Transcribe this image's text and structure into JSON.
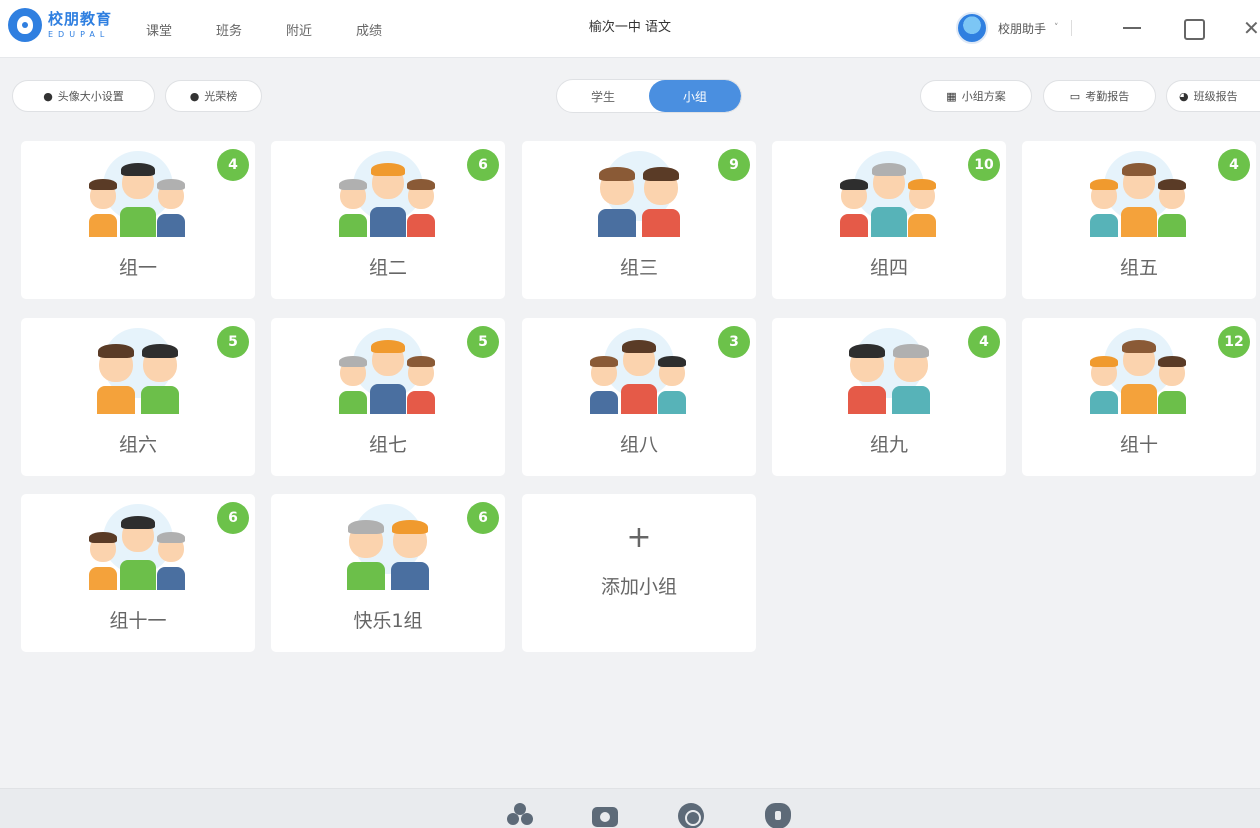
{
  "header": {
    "logo_cn": "校朋教育",
    "logo_en": "EDUPAL",
    "nav": [
      "课堂",
      "班务",
      "附近",
      "成绩"
    ],
    "title": "榆次一中 语文",
    "user_name": "校朋助手",
    "user_chevron": "˅",
    "close_glyph": "✕"
  },
  "toolbar": {
    "avatar_size_label": "头像大小设置",
    "honor_roll_label": "光荣榜",
    "segments": [
      "学生",
      "小组"
    ],
    "active_segment": "小组",
    "group_plan_label": "小组方案",
    "attendance_label": "考勤报告",
    "class_report_label": "班级报告"
  },
  "groups": [
    {
      "name": "组一",
      "count": "4"
    },
    {
      "name": "组二",
      "count": "6"
    },
    {
      "name": "组三",
      "count": "9"
    },
    {
      "name": "组四",
      "count": "10"
    },
    {
      "name": "组五",
      "count": "4"
    },
    {
      "name": "组六",
      "count": "5"
    },
    {
      "name": "组七",
      "count": "5"
    },
    {
      "name": "组八",
      "count": "3"
    },
    {
      "name": "组九",
      "count": "4"
    },
    {
      "name": "组十",
      "count": "12"
    },
    {
      "name": "组十一",
      "count": "6"
    },
    {
      "name": "快乐1组",
      "count": "6"
    }
  ],
  "add_group": {
    "plus": "+",
    "label": "添加小组"
  },
  "bottom_icons": [
    "group-icon",
    "camera-icon",
    "stats-icon",
    "shield-icon"
  ],
  "colors": {
    "accent": "#4a8fe0",
    "badge": "#6cc24a",
    "logo": "#2f7fe0"
  }
}
